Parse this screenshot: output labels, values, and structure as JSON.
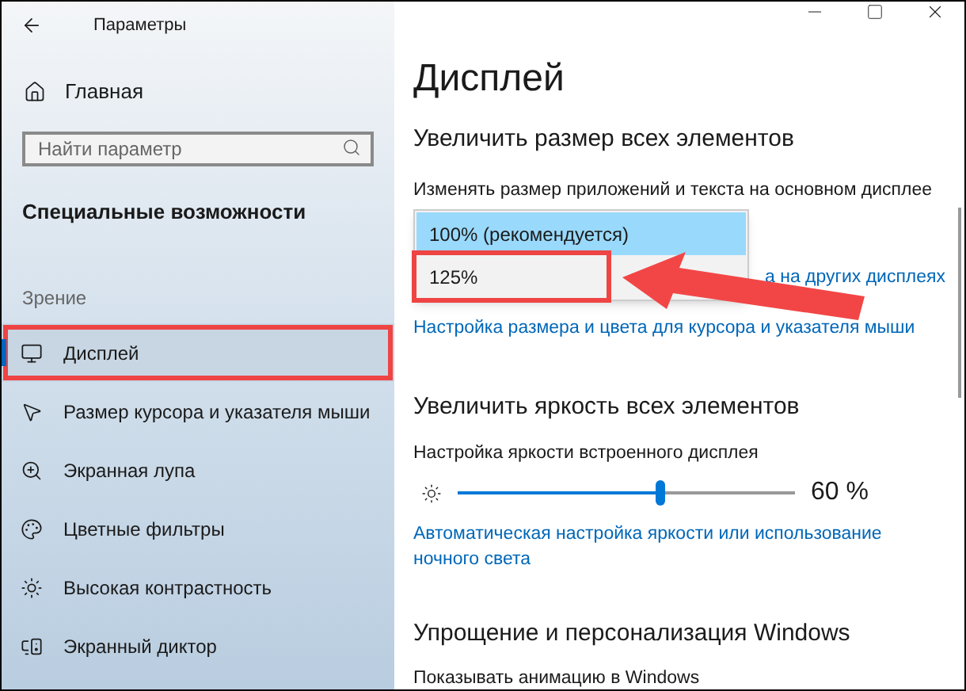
{
  "window": {
    "title": "Параметры"
  },
  "sidebar": {
    "home": "Главная",
    "search": {
      "placeholder": "Найти параметр"
    },
    "section": "Специальные возможности",
    "group": "Зрение",
    "items": [
      {
        "label": "Дисплей",
        "selected": true,
        "annotated": true
      },
      {
        "label": "Размер курсора и указателя мыши",
        "selected": false,
        "annotated": false
      },
      {
        "label": "Экранная лупа",
        "selected": false,
        "annotated": false
      },
      {
        "label": "Цветные фильтры",
        "selected": false,
        "annotated": false
      },
      {
        "label": "Высокая контрастность",
        "selected": false,
        "annotated": false
      },
      {
        "label": "Экранный диктор",
        "selected": false,
        "annotated": false
      }
    ]
  },
  "main": {
    "title": "Дисплей",
    "size_section": {
      "heading": "Увеличить размер всех элементов",
      "label": "Изменять размер приложений и текста на основном дисплее",
      "dropdown": {
        "expanded": true,
        "options": [
          {
            "label": "100% (рекомендуется)",
            "selected": true,
            "annotated": false
          },
          {
            "label": "125%",
            "selected": false,
            "annotated": true
          }
        ]
      },
      "links": [
        "а на других дисплеях",
        "Настройка размера и цвета для курсора и указателя мыши"
      ]
    },
    "brightness_section": {
      "heading": "Увеличить яркость всех элементов",
      "label": "Настройка яркости встроенного дисплея",
      "slider": {
        "level": 0.6
      },
      "reading": "60 %",
      "link": "Автоматическая настройка яркости или использование ночного света"
    },
    "simplify_section": {
      "heading": "Упрощение и персонализация Windows",
      "label": "Показывать анимацию в Windows"
    }
  }
}
